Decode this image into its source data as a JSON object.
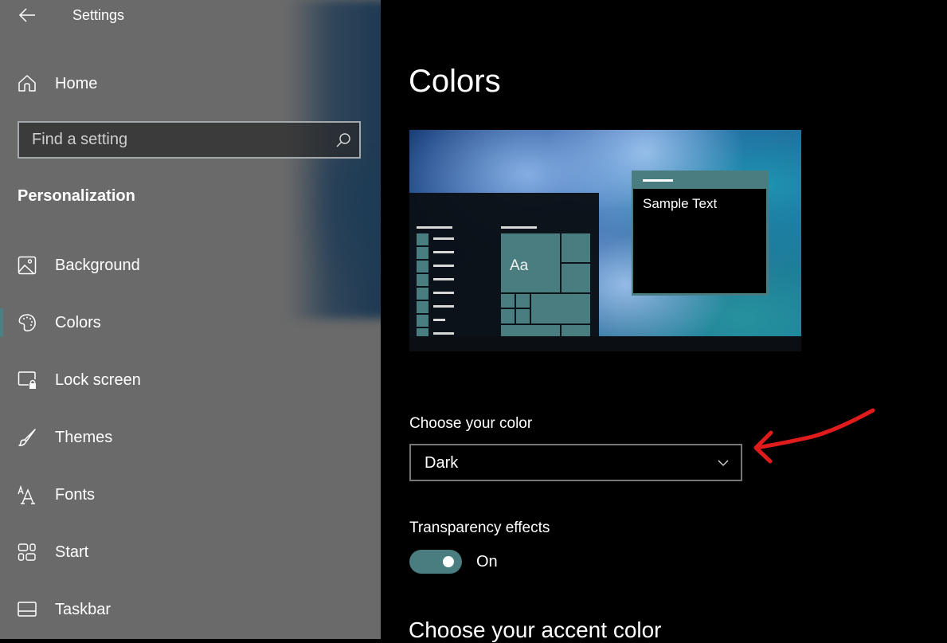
{
  "window": {
    "title": "Settings"
  },
  "sidebar": {
    "home_label": "Home",
    "search": {
      "placeholder": "Find a setting",
      "value": ""
    },
    "section_title": "Personalization",
    "items": [
      {
        "label": "Background",
        "icon": "picture-icon",
        "active": false
      },
      {
        "label": "Colors",
        "icon": "palette-icon",
        "active": true
      },
      {
        "label": "Lock screen",
        "icon": "lock-screen-icon",
        "active": false
      },
      {
        "label": "Themes",
        "icon": "brush-icon",
        "active": false
      },
      {
        "label": "Fonts",
        "icon": "fonts-icon",
        "active": false
      },
      {
        "label": "Start",
        "icon": "start-tiles-icon",
        "active": false
      },
      {
        "label": "Taskbar",
        "icon": "taskbar-icon",
        "active": false
      }
    ]
  },
  "main": {
    "page_title": "Colors",
    "preview": {
      "tile_text": "Aa",
      "sample_text": "Sample Text"
    },
    "choose_color": {
      "label": "Choose your color",
      "selected": "Dark"
    },
    "transparency": {
      "label": "Transparency effects",
      "state": "On",
      "enabled": true
    },
    "accent_title": "Choose your accent color"
  },
  "colors": {
    "accent": "#4a7d80",
    "sidebar_bg": "#6a6a6a",
    "main_bg": "#000000",
    "annotation_arrow": "#e01b1b"
  }
}
